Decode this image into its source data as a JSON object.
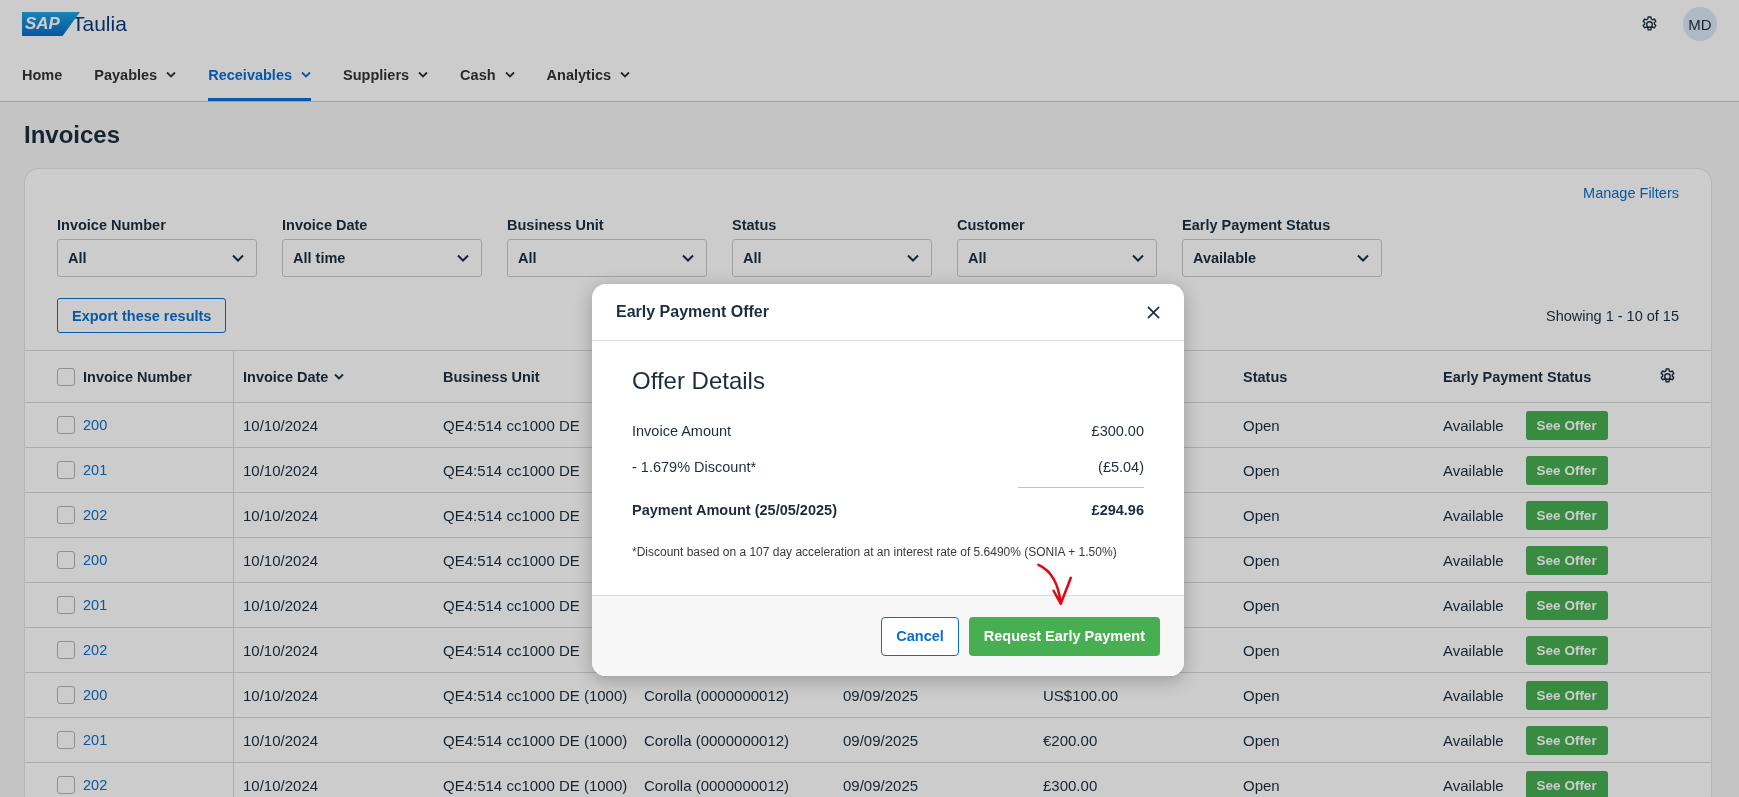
{
  "logo": {
    "mark": "SAP",
    "name": "Taulia"
  },
  "user": {
    "initials": "MD"
  },
  "nav": [
    {
      "label": "Home",
      "selected": false,
      "has_menu": false
    },
    {
      "label": "Payables",
      "selected": false,
      "has_menu": true
    },
    {
      "label": "Receivables",
      "selected": true,
      "has_menu": true
    },
    {
      "label": "Suppliers",
      "selected": false,
      "has_menu": true
    },
    {
      "label": "Cash",
      "selected": false,
      "has_menu": true
    },
    {
      "label": "Analytics",
      "selected": false,
      "has_menu": true
    }
  ],
  "page_title": "Invoices",
  "manage_filters": "Manage Filters",
  "filters": [
    {
      "label": "Invoice Number",
      "value": "All"
    },
    {
      "label": "Invoice Date",
      "value": "All time"
    },
    {
      "label": "Business Unit",
      "value": "All"
    },
    {
      "label": "Status",
      "value": "All"
    },
    {
      "label": "Customer",
      "value": "All"
    },
    {
      "label": "Early Payment Status",
      "value": "Available"
    }
  ],
  "export_button": "Export these results",
  "showing": "Showing 1 - 10 of 15",
  "table": {
    "select_all_checked": false,
    "columns": {
      "invoice_number": "Invoice Number",
      "invoice_date": "Invoice Date",
      "business_unit": "Business Unit",
      "status": "Status",
      "early_payment_status": "Early Payment Status"
    },
    "rows": [
      {
        "checked": false,
        "number": "200",
        "date": "10/10/2024",
        "business_unit": "QE4:514 cc1000 DE",
        "status": "Open",
        "early_payment_status": "Available",
        "action": "See Offer"
      },
      {
        "checked": false,
        "number": "201",
        "date": "10/10/2024",
        "business_unit": "QE4:514 cc1000 DE",
        "status": "Open",
        "early_payment_status": "Available",
        "action": "See Offer"
      },
      {
        "checked": false,
        "number": "202",
        "date": "10/10/2024",
        "business_unit": "QE4:514 cc1000 DE",
        "status": "Open",
        "early_payment_status": "Available",
        "action": "See Offer"
      },
      {
        "checked": false,
        "number": "200",
        "date": "10/10/2024",
        "business_unit": "QE4:514 cc1000 DE",
        "status": "Open",
        "early_payment_status": "Available",
        "action": "See Offer"
      },
      {
        "checked": false,
        "number": "201",
        "date": "10/10/2024",
        "business_unit": "QE4:514 cc1000 DE",
        "status": "Open",
        "early_payment_status": "Available",
        "action": "See Offer"
      },
      {
        "checked": false,
        "number": "202",
        "date": "10/10/2024",
        "business_unit": "QE4:514 cc1000 DE",
        "status": "Open",
        "early_payment_status": "Available",
        "action": "See Offer"
      },
      {
        "checked": false,
        "number": "200",
        "date": "10/10/2024",
        "business_unit": "QE4:514 cc1000 DE (1000)",
        "customer": "Corolla (0000000012)",
        "due_date": "09/09/2025",
        "amount": "US$100.00",
        "status": "Open",
        "early_payment_status": "Available",
        "action": "See Offer"
      },
      {
        "checked": false,
        "number": "201",
        "date": "10/10/2024",
        "business_unit": "QE4:514 cc1000 DE (1000)",
        "customer": "Corolla (0000000012)",
        "due_date": "09/09/2025",
        "amount": "€200.00",
        "status": "Open",
        "early_payment_status": "Available",
        "action": "See Offer"
      },
      {
        "checked": false,
        "number": "202",
        "date": "10/10/2024",
        "business_unit": "QE4:514 cc1000 DE (1000)",
        "customer": "Corolla (0000000012)",
        "due_date": "09/09/2025",
        "amount": "£300.00",
        "status": "Open",
        "early_payment_status": "Available",
        "action": "See Offer"
      }
    ]
  },
  "modal": {
    "title": "Early Payment Offer",
    "heading": "Offer Details",
    "lines": [
      {
        "kind": "plain",
        "label": "Invoice Amount",
        "value": "£300.00"
      },
      {
        "kind": "plain",
        "label": "- 1.679% Discount*",
        "value": "(£5.04)"
      },
      {
        "kind": "total",
        "label": "Payment Amount (25/05/2025)",
        "value": "£294.96"
      }
    ],
    "footnote": "*Discount based on a 107 day acceleration at an interest rate of 5.6490% (SONIA + 1.50%)",
    "cancel": "Cancel",
    "confirm": "Request Early Payment"
  }
}
